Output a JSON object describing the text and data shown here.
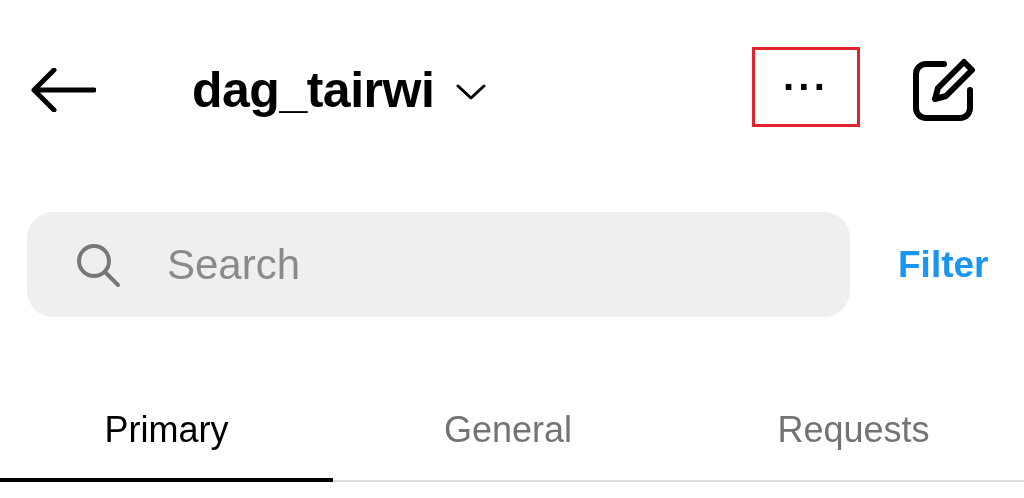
{
  "header": {
    "username": "dag_tairwi",
    "more_button": {
      "label": "···",
      "highlighted": true
    }
  },
  "search": {
    "placeholder": "Search"
  },
  "filter": "Filter",
  "tabs": [
    {
      "label": "Primary",
      "selected": true
    },
    {
      "label": "General",
      "selected": false
    },
    {
      "label": "Requests",
      "selected": false
    }
  ]
}
